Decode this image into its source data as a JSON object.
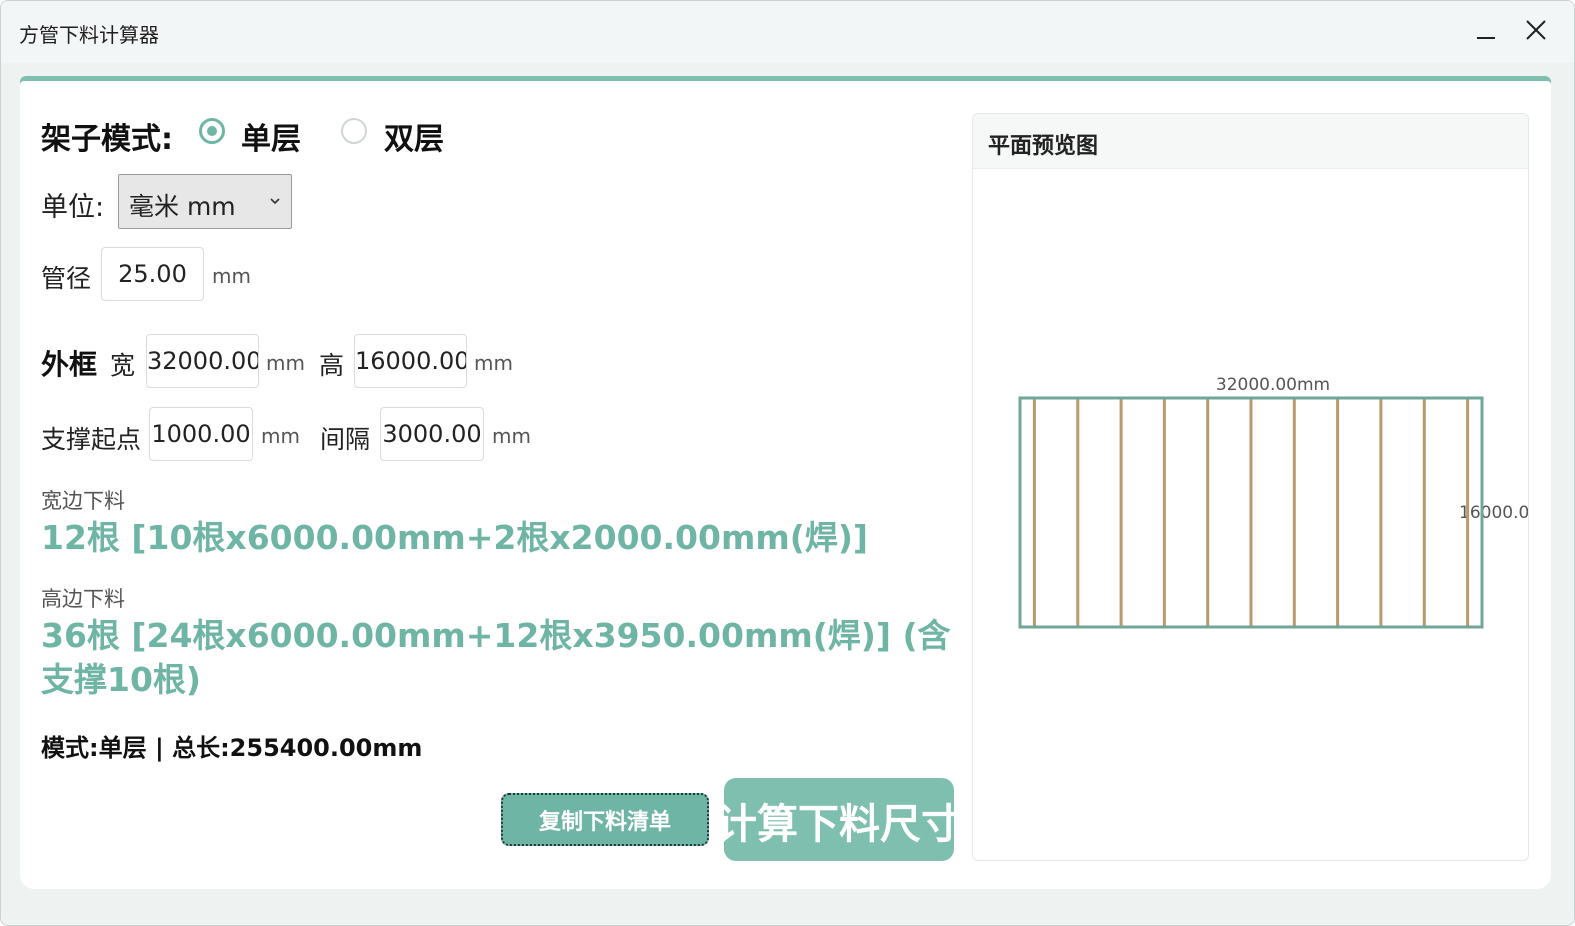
{
  "window": {
    "title": "方管下料计算器"
  },
  "form": {
    "mode_label": "架子模式:",
    "mode_options": [
      "单层",
      "双层"
    ],
    "mode_selected": "单层",
    "unit_label": "单位:",
    "unit_value": "毫米 mm",
    "pipe_label": "管径",
    "pipe_value": "25.00",
    "pipe_unit": "mm",
    "frame_label": "外框",
    "width_label": "宽",
    "width_value": "32000.00",
    "width_unit": "mm",
    "height_label": "高",
    "height_value": "16000.00",
    "height_unit": "mm",
    "support_start_label": "支撑起点",
    "support_start_value": "1000.00",
    "support_start_unit": "mm",
    "interval_label": "间隔",
    "interval_value": "3000.00",
    "interval_unit": "mm"
  },
  "results": {
    "width_label": "宽边下料",
    "width_result": "12根 [10根x6000.00mm+2根x2000.00mm(焊)]",
    "height_label": "高边下料",
    "height_result": "36根 [24根x6000.00mm+12根x3950.00mm(焊)] (含支撑10根)",
    "summary": "模式:单层 | 总长:255400.00mm"
  },
  "buttons": {
    "copy_label": "复制下料清单",
    "calc_label": "计算下料尺寸"
  },
  "preview": {
    "title": "平面预览图",
    "width_text": "32000.00mm",
    "height_text": "16000.0",
    "frame_width_mm": 32000,
    "support_start_mm": 1000,
    "support_interval_mm": 3000,
    "support_count": 10
  },
  "colors": {
    "accent": "#6fb5a6",
    "frame": "#6fa79a",
    "support": "#b99a6c"
  }
}
